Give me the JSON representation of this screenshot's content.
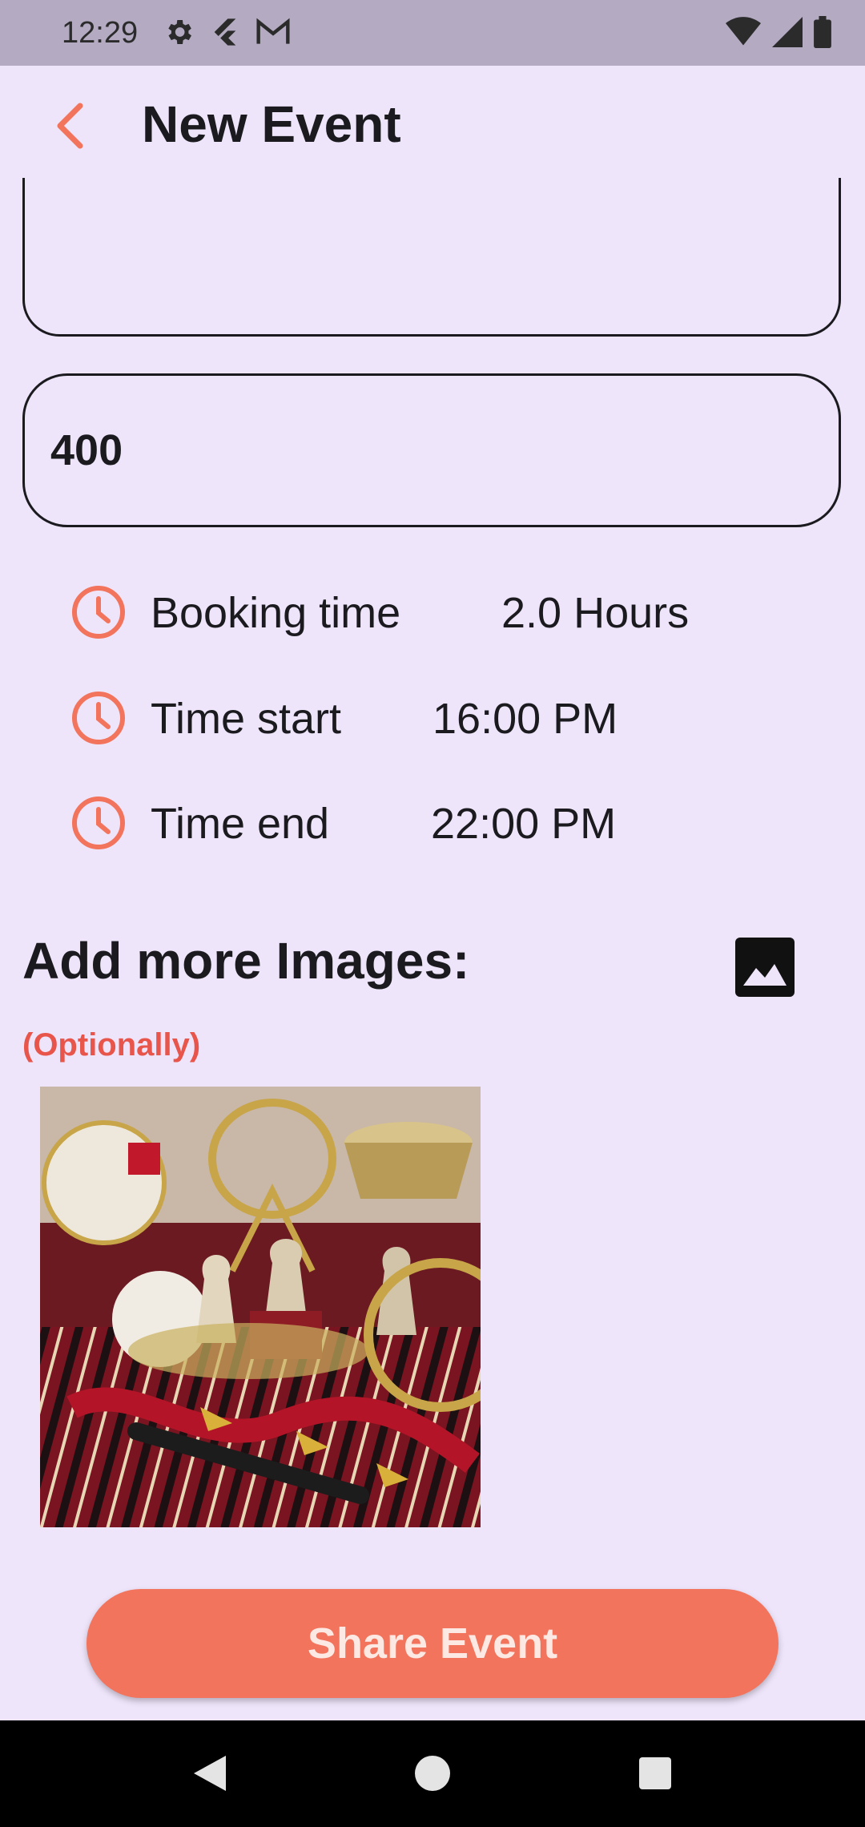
{
  "status_bar": {
    "time": "12:29",
    "left_icons": [
      "gear-icon",
      "flutter-icon",
      "gmail-icon"
    ],
    "right_icons": [
      "wifi-icon",
      "signal-icon",
      "battery-icon"
    ]
  },
  "app_bar": {
    "title": "New Event",
    "back_icon": "chevron-left-icon",
    "accent_color": "#f2745c"
  },
  "form": {
    "description_value": "",
    "price_value": "400"
  },
  "time_rows": [
    {
      "label": "Booking time",
      "value": "2.0 Hours",
      "icon": "clock-icon"
    },
    {
      "label": "Time start",
      "value": "16:00 PM",
      "icon": "clock-icon"
    },
    {
      "label": "Time end",
      "value": "22:00 PM",
      "icon": "clock-icon"
    }
  ],
  "images_section": {
    "title": "Add more Images:",
    "optional_note": "(Optionally)",
    "optional_color": "#e8554b",
    "add_icon": "image-icon"
  },
  "share_button": {
    "label": "Share Event",
    "color": "#f2745c"
  },
  "nav_bar": {
    "icons": [
      "back-triangle-icon",
      "home-circle-icon",
      "recents-square-icon"
    ]
  },
  "colors": {
    "background": "#efe5fb",
    "status_bar": "#b4abc2"
  }
}
